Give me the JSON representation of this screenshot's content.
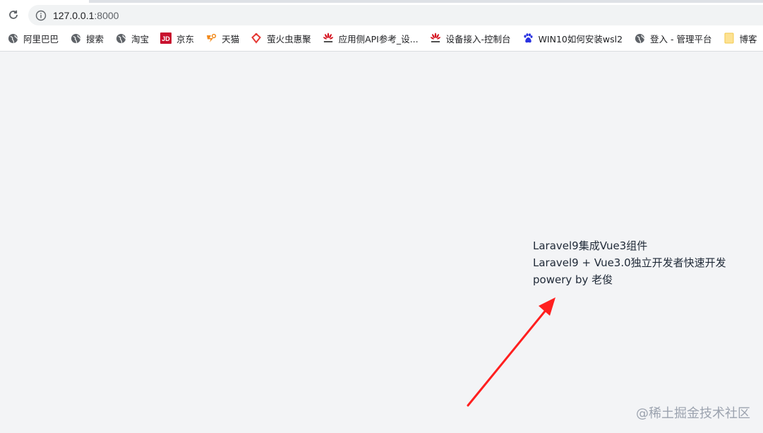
{
  "browser": {
    "url_host": "127.0.0.1",
    "url_port": ":8000"
  },
  "bookmarks": [
    {
      "label": "阿里巴巴",
      "icon": "globe-icon"
    },
    {
      "label": "搜索",
      "icon": "globe-icon"
    },
    {
      "label": "淘宝",
      "icon": "globe-icon"
    },
    {
      "label": "京东",
      "icon": "jd-icon"
    },
    {
      "label": "天猫",
      "icon": "tmall-icon"
    },
    {
      "label": "萤火虫惠聚",
      "icon": "firefly-icon"
    },
    {
      "label": "应用侧API参考_设...",
      "icon": "huawei-icon"
    },
    {
      "label": "设备接入-控制台",
      "icon": "huawei-icon"
    },
    {
      "label": "WIN10如何安装wsl2",
      "icon": "baidu-icon"
    },
    {
      "label": "登入 - 管理平台",
      "icon": "globe-icon"
    },
    {
      "label": "博客",
      "icon": "folder-icon"
    }
  ],
  "page": {
    "line1": "Laravel9集成Vue3组件",
    "line2": "Laravel9 + Vue3.0独立开发者快速开发",
    "line3": "powery by 老俊"
  },
  "watermark": "@稀土掘金技术社区",
  "colors": {
    "arrow": "#ff1f1f",
    "background": "#f3f4f6"
  }
}
